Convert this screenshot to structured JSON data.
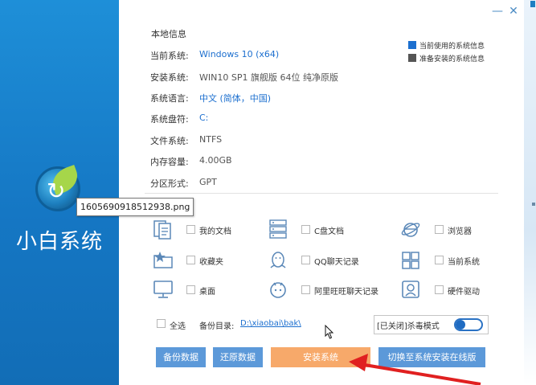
{
  "window": {
    "title_buttons": [
      "—",
      "✕"
    ]
  },
  "brand": {
    "name": "小白系统"
  },
  "info": {
    "section_title": "本地信息",
    "rows": [
      {
        "label": "当前系统:",
        "value": "Windows 10 (x64)"
      },
      {
        "label": "安装系统:",
        "value": "WIN10 SP1 旗舰版 64位 纯净原版"
      },
      {
        "label": "系统语言:",
        "value": "中文 (简体，中国)"
      },
      {
        "label": "系统盘符:",
        "value": "C:"
      },
      {
        "label": "文件系统:",
        "value": "NTFS"
      },
      {
        "label": "内存容量:",
        "value": "4.00GB"
      },
      {
        "label": "分区形式:",
        "value": "GPT"
      }
    ]
  },
  "legend": [
    {
      "label": "当前使用的系统信息",
      "color": "#1c6fcf"
    },
    {
      "label": "准备安装的系统信息",
      "color": "#555555"
    }
  ],
  "backup_options": [
    {
      "label": "我的文档",
      "icon": "document-icon"
    },
    {
      "label": "C盘文档",
      "icon": "server-icon"
    },
    {
      "label": "浏览器",
      "icon": "browser-icon"
    },
    {
      "label": "收藏夹",
      "icon": "favorites-folder-icon"
    },
    {
      "label": "QQ聊天记录",
      "icon": "qq-icon"
    },
    {
      "label": "当前系统",
      "icon": "windows-icon"
    },
    {
      "label": "桌面",
      "icon": "monitor-icon"
    },
    {
      "label": "阿里旺旺聊天记录",
      "icon": "wangwang-icon"
    },
    {
      "label": "硬件驱动",
      "icon": "driver-icon"
    }
  ],
  "select_all": "全选",
  "backup_dir": {
    "label": "备份目录:",
    "path": "D:\\xiaobai\\bak\\"
  },
  "antivirus": {
    "label": "[已关闭]杀毒模式"
  },
  "tooltip": "1605690918512938.png",
  "buttons": {
    "backup": "备份数据",
    "restore": "还原数据",
    "install": "安装系统",
    "online": "切换至系统安装在线版"
  },
  "colors": {
    "accent": "#5c99d9",
    "install": "#f7a96a",
    "brand_bg": "#1a7fc9",
    "arrow": "#e02020"
  }
}
